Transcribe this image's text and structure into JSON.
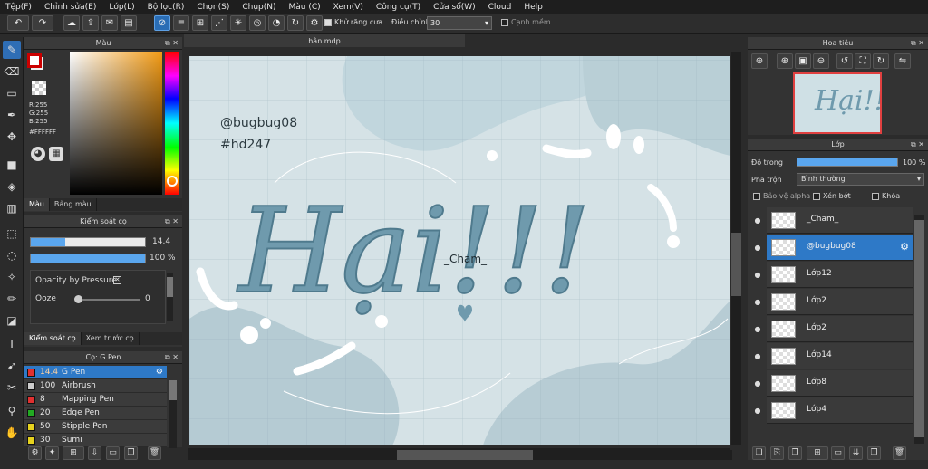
{
  "menu": [
    "Tệp(F)",
    "Chỉnh sửa(E)",
    "Lớp(L)",
    "Bộ lọc(R)",
    "Chọn(S)",
    "Chụp(N)",
    "Màu (C)",
    "Xem(V)",
    "Công cụ(T)",
    "Cửa sổ(W)",
    "Cloud",
    "Help"
  ],
  "toolbar": {
    "antialias_label": "Khử răng cưa",
    "adjust_label": "Điều chỉnh",
    "adjust_value": "30",
    "smooth_label": "Cạnh mềm"
  },
  "color_panel": {
    "title": "Màu",
    "rgb": [
      "R:255",
      "G:255",
      "B:255"
    ],
    "hex": "#FFFFFF",
    "tabs": [
      "Màu",
      "Bảng màu"
    ],
    "primary_color": "#ffffff",
    "secondary_color": "#cc0000"
  },
  "brush_control": {
    "title": "Kiểm soát cọ",
    "size_value": "14.4",
    "size_fraction": 0.3,
    "opacity_value": "100 %",
    "opacity_fraction": 1.0,
    "pressure_label": "Opacity by Pressure",
    "ooze_label": "Ooze",
    "ooze_value": "0",
    "tabs": [
      "Kiểm soát cọ",
      "Xem trước cọ"
    ]
  },
  "brushes": {
    "title": "Cọ: G Pen",
    "items": [
      {
        "size": "14.4",
        "name": "G Pen",
        "color": "#e03030"
      },
      {
        "size": "100",
        "name": "Airbrush",
        "color": "#cccccc"
      },
      {
        "size": "8",
        "name": "Mapping Pen",
        "color": "#e03030"
      },
      {
        "size": "20",
        "name": "Edge Pen",
        "color": "#22aa22"
      },
      {
        "size": "50",
        "name": "Stipple Pen",
        "color": "#e6d21e"
      },
      {
        "size": "30",
        "name": "Sumi",
        "color": "#e6d21e"
      }
    ]
  },
  "canvas": {
    "filename": "hân.mdp",
    "text_handle": "@bugbug08",
    "text_tag": "#hd247",
    "text_main": "Hại!!!",
    "text_cham": "_Cham_"
  },
  "navigator": {
    "title": "Hoa tiêu"
  },
  "layers": {
    "title": "Lớp",
    "opacity_label": "Độ trong",
    "opacity_value": "100 %",
    "opacity_fraction": 1.0,
    "blend_label": "Pha trộn",
    "blend_value": "Bình thường",
    "protect_alpha": "Bảo vệ alpha",
    "clipping": "Xén bớt",
    "lock": "Khóa",
    "items": [
      "_Cham_",
      "@bugbug08",
      "Lớp12",
      "Lớp2",
      "Lớp2",
      "Lớp14",
      "Lớp8",
      "Lớp4"
    ]
  }
}
